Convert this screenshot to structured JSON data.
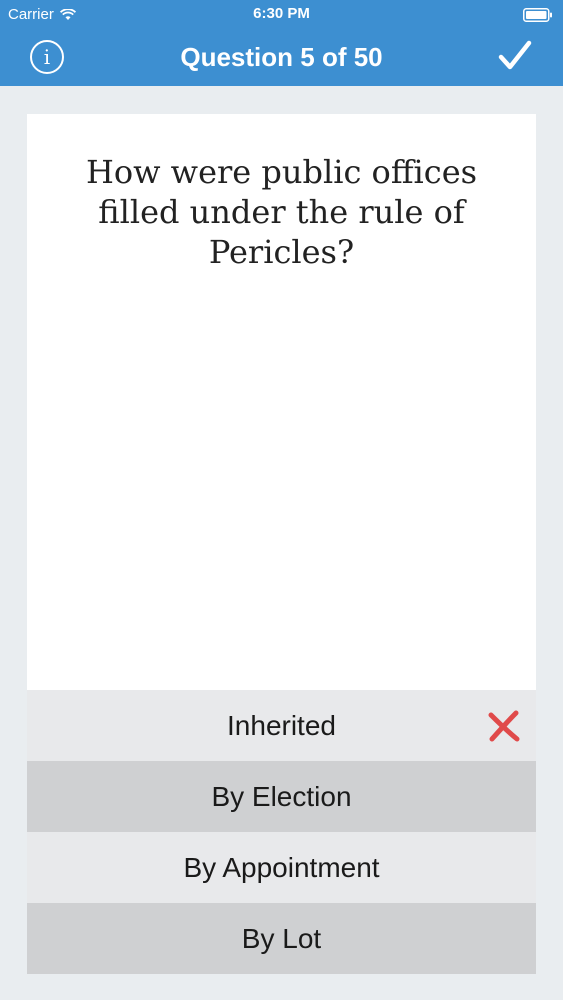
{
  "status_bar": {
    "carrier": "Carrier",
    "time": "6:30 PM",
    "icons": [
      "wifi-icon",
      "battery-icon"
    ]
  },
  "nav": {
    "title": "Question 5 of 50",
    "info_icon": "info-icon",
    "info_glyph": "i",
    "confirm_icon": "checkmark-icon"
  },
  "question": {
    "text": "How were public offices filled under the rule of Pericles?"
  },
  "answers": [
    {
      "label": "Inherited",
      "marked_wrong": true
    },
    {
      "label": "By Election",
      "marked_wrong": false
    },
    {
      "label": "By Appointment",
      "marked_wrong": false
    },
    {
      "label": "By Lot",
      "marked_wrong": false
    }
  ],
  "colors": {
    "header": "#3d8fd1",
    "background": "#e9edf0",
    "wrong_mark": "#e04a4a",
    "answer_light": "#e8e9eb",
    "answer_dark": "#cfd0d2"
  }
}
